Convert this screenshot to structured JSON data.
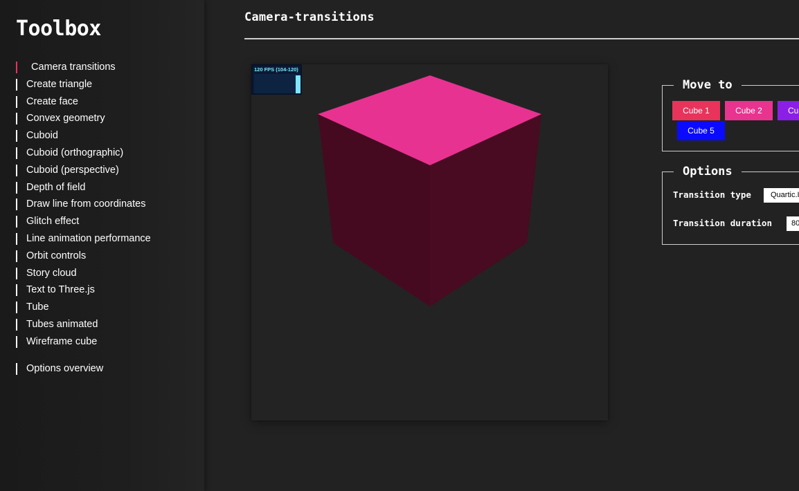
{
  "sidebar": {
    "brand": "Toolbox",
    "items": [
      {
        "label": "Camera transitions"
      },
      {
        "label": "Create triangle"
      },
      {
        "label": "Create face"
      },
      {
        "label": "Convex geometry"
      },
      {
        "label": "Cuboid"
      },
      {
        "label": "Cuboid (orthographic)"
      },
      {
        "label": "Cuboid (perspective)"
      },
      {
        "label": "Depth of field"
      },
      {
        "label": "Draw line from coordinates"
      },
      {
        "label": "Glitch effect"
      },
      {
        "label": "Line animation performance"
      },
      {
        "label": "Orbit controls"
      },
      {
        "label": "Story cloud"
      },
      {
        "label": "Text to Three.js"
      },
      {
        "label": "Tube"
      },
      {
        "label": "Tubes animated"
      },
      {
        "label": "Wireframe cube"
      }
    ],
    "footer_item": {
      "label": "Options overview"
    }
  },
  "header": {
    "title": "Camera-transitions"
  },
  "stats": {
    "fps_label": "120 FPS (104-120)"
  },
  "move_to": {
    "legend": "Move to",
    "buttons": [
      {
        "label": "Cube 1",
        "color": "#e8335b"
      },
      {
        "label": "Cube 2",
        "color": "#e8338f"
      },
      {
        "label": "Cu",
        "color": "#8b1fe6"
      },
      {
        "label": "Cube 5",
        "color": "#0a0aff"
      }
    ]
  },
  "options": {
    "legend": "Options",
    "transition_type_label": "Transition type",
    "transition_type_value": "Quartic.I",
    "transition_duration_label": "Transition duration",
    "transition_duration_value": "80"
  },
  "colors": {
    "accent": "#e8335b",
    "cube_top": "#e83291",
    "cube_side": "#470a20"
  }
}
